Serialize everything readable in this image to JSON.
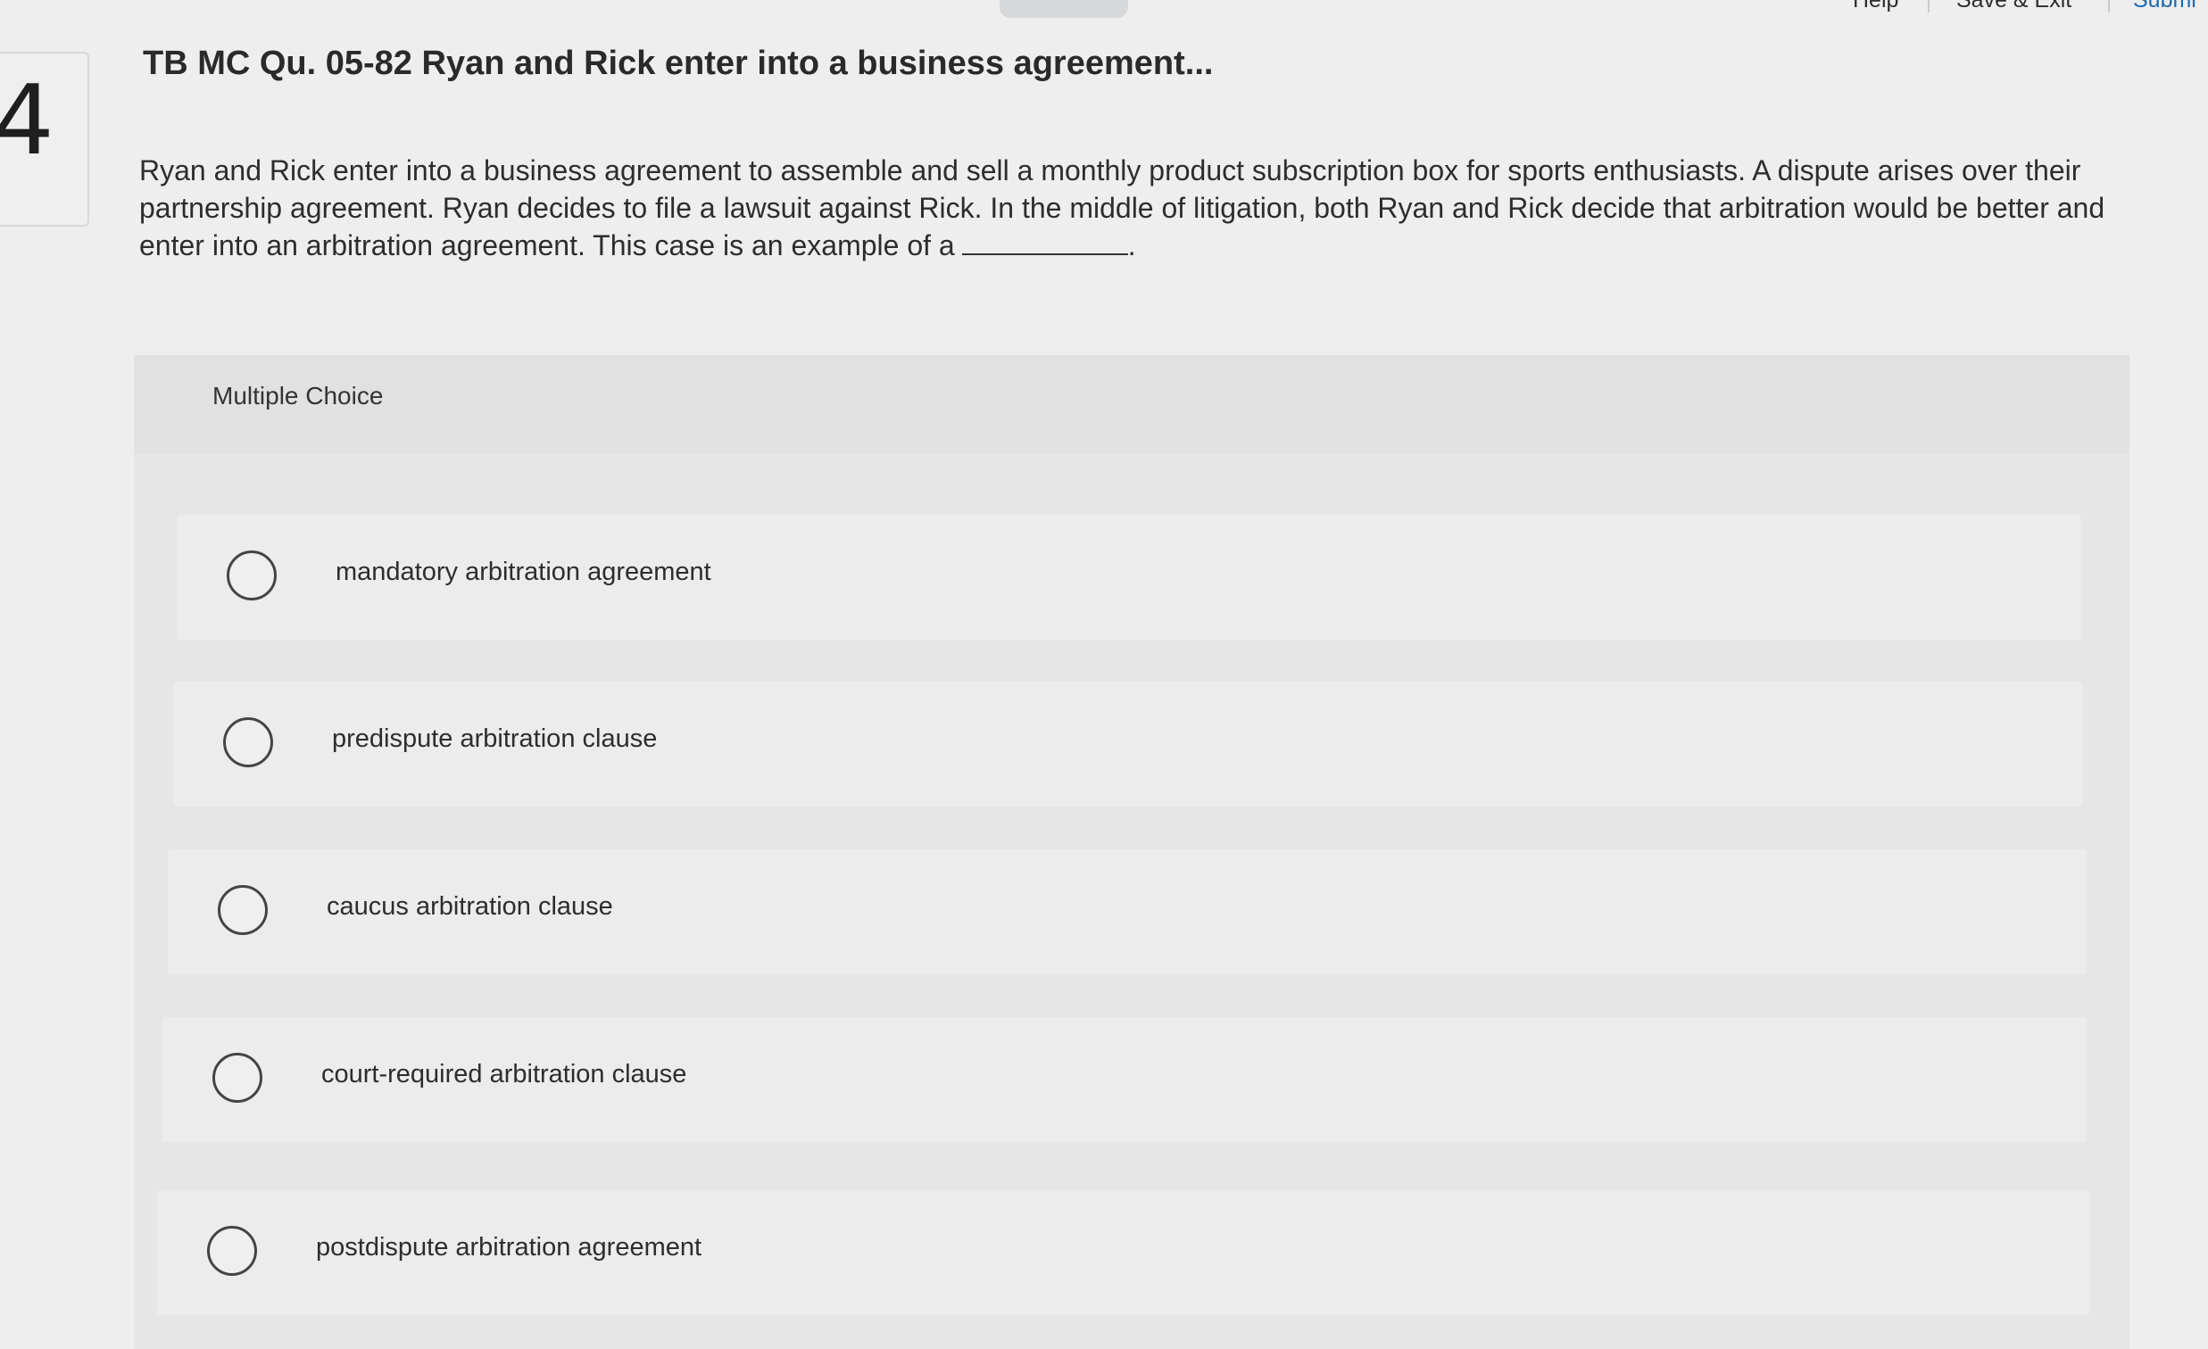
{
  "header": {
    "help_label": "Help",
    "save_exit_label": "Save & Exit",
    "submit_label": "Submi"
  },
  "question": {
    "number": "4",
    "title": "TB MC Qu. 05-82 Ryan and Rick enter into a business agreement...",
    "prompt": "Ryan and Rick enter into a business agreement to assemble and sell a monthly product subscription box for sports enthusiasts. A dispute arises over their partnership agreement. Ryan decides to file a lawsuit against Rick. In the middle of litigation, both Ryan and Rick decide that arbitration would be better and enter into an arbitration agreement. This case is an example of a",
    "prompt_end": "."
  },
  "multiple_choice": {
    "label": "Multiple Choice",
    "options": [
      {
        "label": "mandatory arbitration agreement",
        "selected": false
      },
      {
        "label": "predispute arbitration clause",
        "selected": false
      },
      {
        "label": "caucus arbitration clause",
        "selected": false
      },
      {
        "label": "court-required arbitration clause",
        "selected": false
      },
      {
        "label": "postdispute arbitration agreement",
        "selected": false
      }
    ]
  },
  "colors": {
    "background": "#eeeeee",
    "panel": "#e6e6e6",
    "link": "#1a6bb0"
  }
}
